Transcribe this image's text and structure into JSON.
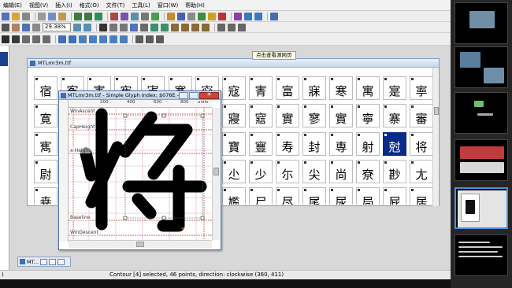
{
  "menus": [
    "编辑(E)",
    "视图(V)",
    "插入(I)",
    "格式(O)",
    "文件(T)",
    "工具(L)",
    "窗口(W)",
    "帮助(H)"
  ],
  "toolbar": {
    "zoom_value": "29.38%"
  },
  "tooltip": "点击查看源网页",
  "font_window": {
    "title": "MTLmr3m.ttf",
    "rows": [
      [
        "宿",
        "寃",
        "寈",
        "寉",
        "寊",
        "寋",
        "寍",
        "寇",
        "寈",
        "富",
        "寐",
        "寒",
        "寓",
        "寔",
        "寕"
      ],
      [
        "寛",
        "寜",
        "寝",
        "寞",
        "察",
        "寠",
        "寡",
        "寢",
        "寣",
        "實",
        "寥",
        "實",
        "寧",
        "寨",
        "審"
      ],
      [
        "寯",
        "寰",
        "寱",
        "寲",
        "寳",
        "寴",
        "寵",
        "寶",
        "寷",
        "寿",
        "封",
        "専",
        "射",
        "尅",
        "将",
        "將",
        "專"
      ],
      [
        "尉",
        "尊",
        "尋",
        "尌",
        "對",
        "導",
        "小",
        "尐",
        "少",
        "尓",
        "尖",
        "尚",
        "尞",
        "尠",
        "尢",
        "尤",
        "尨"
      ],
      [
        "尭",
        "就",
        "尰",
        "尲",
        "尳",
        "尵",
        "尶",
        "尷",
        "尸",
        "尽",
        "尾",
        "尿",
        "局",
        "屁",
        "居",
        "屆",
        "屈"
      ]
    ]
  },
  "glyph_window": {
    "title": "MTLmr3m.ttf - Simple Glyph Index: $076E - ...",
    "ruler_top": [
      "200",
      "400",
      "600",
      "800",
      "1000"
    ],
    "ruler_units": "units",
    "metrics": {
      "win_ascent": "WinAscent",
      "cap_height": "CapHeight",
      "x_height": "x-Height",
      "baseline": "Baseline",
      "win_descent": "WinDescent"
    }
  },
  "minimized": {
    "title": "MT..."
  },
  "status": {
    "left": ")",
    "main": "Contour [4] selected, 46 points, direction: clockwise (360, 411)"
  },
  "colors": {
    "selection": "#0a2a8a",
    "titlebar": "#c9d8ec",
    "metric_line": "#c0392b",
    "grid_line": "#e8a8c8"
  },
  "icons": [
    "save-icon",
    "open-icon",
    "undo-icon",
    "zoom-icon",
    "pointer-icon",
    "pen-icon",
    "grid-icon"
  ]
}
